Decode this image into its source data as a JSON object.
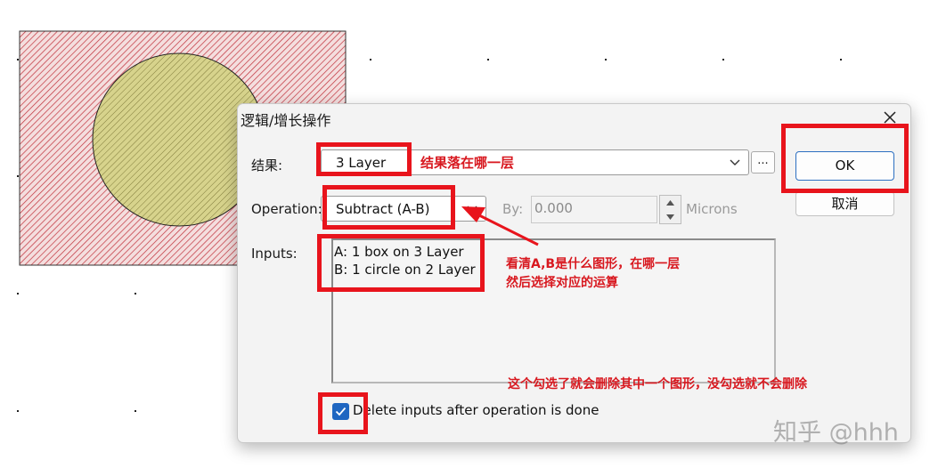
{
  "dialog": {
    "title": "逻辑/增长操作",
    "result_label": "结果:",
    "result_value": "3 Layer",
    "operation_label": "Operation:",
    "operation_value": "Subtract (A-B)",
    "by_label": "By:",
    "by_value": "0.000",
    "units_label": "Microns",
    "inputs_label": "Inputs:",
    "inputs": [
      "A: 1 box on 3 Layer",
      "B: 1 circle on 2 Layer"
    ],
    "browse_label": "...",
    "ok_label": "OK",
    "cancel_label": "取消",
    "delete_checkbox_label": "Delete inputs after operation is done",
    "delete_checkbox_checked": true
  },
  "annotations": {
    "result_note": "结果落在哪一层",
    "inputs_note_line1": "看清A,B是什么图形，在哪一层",
    "inputs_note_line2": "然后选择对应的运算",
    "checkbox_note": "这个勾选了就会删除其中一个图形，没勾选就不会删除"
  },
  "watermark": "知乎 @hhh",
  "colors": {
    "annotation_red": "#e8141c",
    "box_hatch": "#c0303a",
    "box_fill": "#f4dede",
    "circle_fill": "#d7d38c",
    "accent_blue": "#1f66c1"
  },
  "icons": {
    "close": "close-icon",
    "dropdown": "chevron-down-icon",
    "checkmark": "checkmark-icon",
    "spinner_up": "triangle-up-icon",
    "spinner_down": "triangle-down-icon"
  }
}
